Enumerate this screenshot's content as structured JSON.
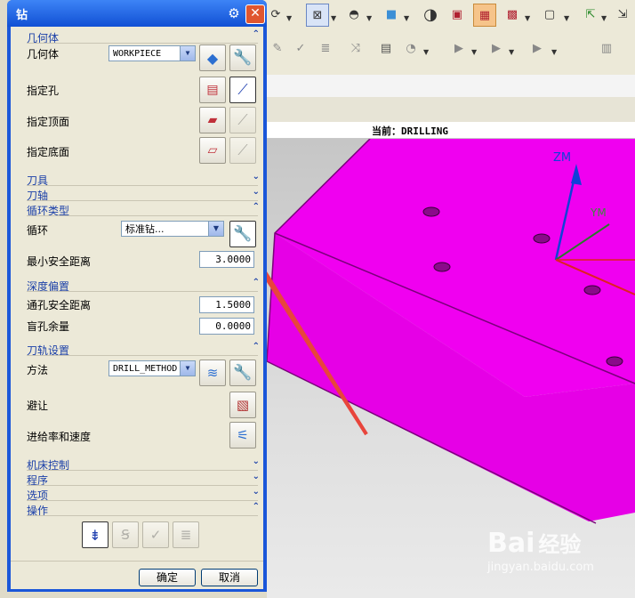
{
  "dialog": {
    "title": "钻",
    "sections": {
      "geometry": "几何体",
      "tool": "刀具",
      "tool_axis": "刀轴",
      "cycle_type": "循环类型",
      "depth_offset": "深度偏置",
      "toolpath_settings": "刀轨设置",
      "machine_control": "机床控制",
      "program": "程序",
      "options": "选项",
      "actions": "操作"
    },
    "geometry": {
      "label": "几何体",
      "value": "WORKPIECE",
      "specify_holes": "指定孔",
      "specify_top": "指定顶面",
      "specify_bottom": "指定底面"
    },
    "cycle": {
      "label": "循环",
      "value": "标准钻...",
      "min_clearance_label": "最小安全距离",
      "min_clearance_value": "3.0000"
    },
    "depth": {
      "through_label": "通孔安全距离",
      "through_value": "1.5000",
      "blind_label": "盲孔余量",
      "blind_value": "0.0000"
    },
    "toolpath": {
      "method_label": "方法",
      "method_value": "DRILL_METHOD",
      "avoid_label": "避让",
      "feeds_label": "进给率和速度"
    },
    "ok_label": "确定",
    "cancel_label": "取消"
  },
  "viewport": {
    "title": "当前：DRILLING",
    "axis_zm": "ZM",
    "axis_ym": "YM",
    "watermark": "Bai",
    "watermark_cn": "经验",
    "watermark_url": "jingyan.baidu.com"
  },
  "colors": {
    "part": "#f000f0",
    "dialog_frame": "#1a56d9",
    "arrow": "#e8453c"
  }
}
